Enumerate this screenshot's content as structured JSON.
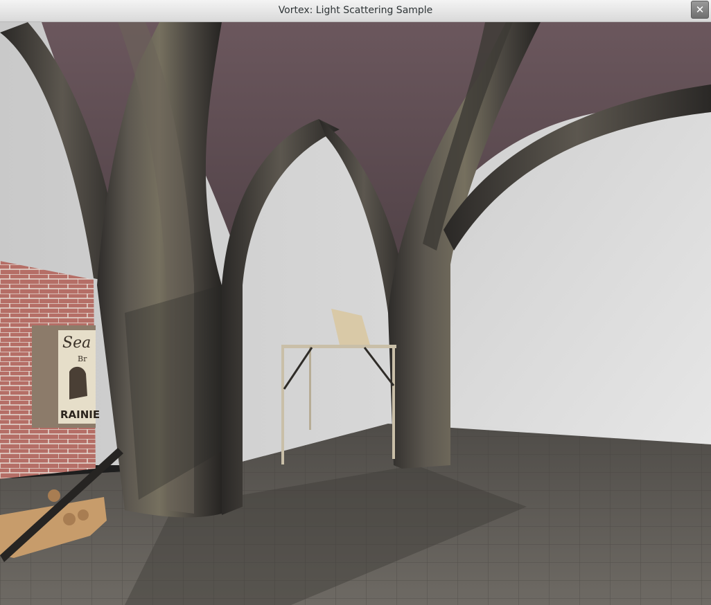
{
  "window": {
    "title": "Vortex: Light Scattering Sample",
    "close_glyph": "✕"
  },
  "scene": {
    "poster": {
      "title_fragment": "Sea",
      "subtitle_fragment": "Br",
      "brand_fragment": "RAINIE"
    },
    "icons": {
      "close": "close-icon"
    },
    "colors": {
      "titlebar": "#e6e6e6",
      "ceiling": "#5e4c52",
      "stone": "#5a554e",
      "wall": "#d2d2d2",
      "floor": "#5b5853",
      "brick": "#b56e66",
      "table_frame": "#c9bfa8"
    }
  }
}
